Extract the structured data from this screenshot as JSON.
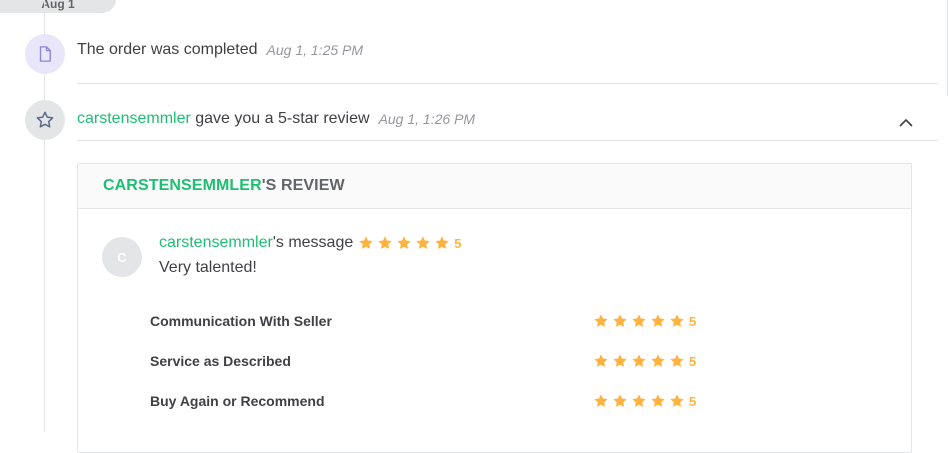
{
  "date_pill": "Aug 1",
  "events": {
    "completed": {
      "text": "The order was completed",
      "timestamp": "Aug 1, 1:25 PM"
    },
    "review": {
      "user": "carstensemmler",
      "text": " gave you a 5-star review",
      "timestamp": "Aug 1, 1:26 PM"
    }
  },
  "review_card": {
    "header_user": "CARSTENSEMMLER",
    "header_suffix": "'S REVIEW",
    "avatar_letter": "C",
    "message_user": "carstensemmler",
    "message_suffix": "'s message",
    "overall_rating": "5",
    "message_text": "Very talented!",
    "criteria": [
      {
        "label": "Communication With Seller",
        "rating": "5"
      },
      {
        "label": "Service as Described",
        "rating": "5"
      },
      {
        "label": "Buy Again or Recommend",
        "rating": "5"
      }
    ]
  },
  "colors": {
    "accent_green": "#1dbf73",
    "star_orange": "#ffb33e",
    "doc_icon_bg": "#e8e6f8"
  },
  "icons": {
    "event1": "document-icon",
    "event2": "star-outline-icon",
    "toggle": "chevron-up-icon",
    "rating": "star-filled-icon"
  }
}
